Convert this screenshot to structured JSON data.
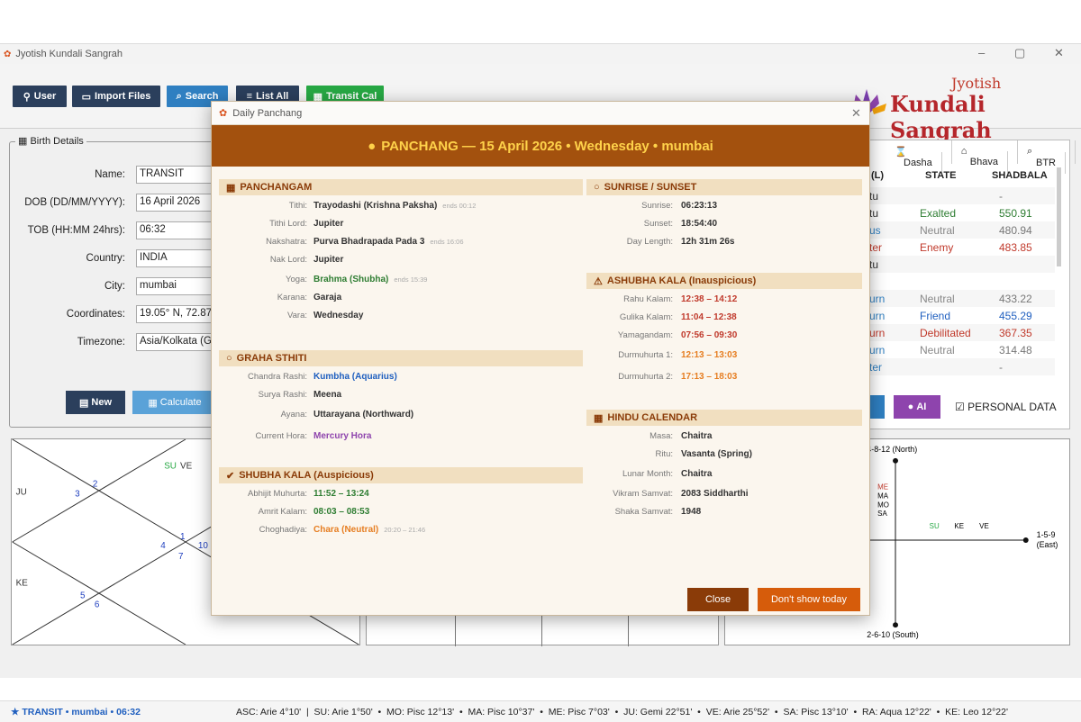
{
  "window": {
    "title": "Jyotish Kundali Sangrah"
  },
  "toolbar": {
    "user": "User",
    "import": "Import Files",
    "search": "Search",
    "listall": "List All",
    "transit": "Transit Cal"
  },
  "logo": {
    "line1": "Jyotish",
    "line2": "Kundali Sangrah"
  },
  "birth": {
    "legend": "Birth Details",
    "name_label": "Name:",
    "name": "TRANSIT",
    "dob_label": "DOB (DD/MM/YYYY):",
    "dob": "16 April 2026",
    "tob_label": "TOB (HH:MM 24hrs):",
    "tob": "06:32",
    "country_label": "Country:",
    "country": "INDIA",
    "city_label": "City:",
    "city": "mumbai",
    "coord_label": "Coordinates:",
    "coord": "19.05° N, 72.87",
    "tz_label": "Timezone:",
    "tz": "Asia/Kolkata (G",
    "new": "New",
    "calculate": "Calculate"
  },
  "rightpanel": {
    "tabs": [
      "Dasha",
      "Bhava",
      "BTR"
    ],
    "headers": [
      "(L)",
      "STATE",
      "SHADBALA"
    ],
    "rows": [
      {
        "l": "tu",
        "state": "",
        "val": "-"
      },
      {
        "l": "tu",
        "state": "Exalted",
        "val": "550.91"
      },
      {
        "l": "us",
        "state": "Neutral",
        "val": "480.94"
      },
      {
        "l": "ter",
        "state": "Enemy",
        "val": "483.85"
      },
      {
        "l": "tu",
        "state": "",
        "val": ""
      },
      {
        "l": "",
        "state": "",
        "val": ""
      },
      {
        "l": "urn",
        "state": "Neutral",
        "val": "433.22"
      },
      {
        "l": "urn",
        "state": "Friend",
        "val": "455.29"
      },
      {
        "l": "urn",
        "state": "Debilitated",
        "val": "367.35"
      },
      {
        "l": "urn",
        "state": "Neutral",
        "val": "314.48"
      },
      {
        "l": "ter",
        "state": "",
        "val": "-"
      }
    ],
    "ai": "AI",
    "personal": "PERSONAL DATA"
  },
  "leftchart": {
    "su": "SU",
    "ve": "VE",
    "ju": "JU",
    "ke": "KE",
    "n2": "2",
    "n3": "3",
    "n4": "4",
    "n1": "1",
    "n7": "7",
    "n10": "10",
    "n5": "5",
    "n6": "6"
  },
  "rightchart": {
    "north": "4-8-12 (North)",
    "south": "2-6-10 (South)",
    "east": "1-5-9\n(East)",
    "me": "ME",
    "ma": "MA",
    "mo": "MO",
    "sa": "SA",
    "su": "SU",
    "ke": "KE",
    "ve": "VE"
  },
  "status": {
    "left": "★ TRANSIT • mumbai • 06:32",
    "right": "ASC: Arie 4°10'  |  SU: Arie 1°50'  •  MO: Pisc 12°13'  •  MA: Pisc 10°37'  •  ME: Pisc 7°03'  •  JU: Gemi 22°51'  •  VE: Arie 25°52'  •  SA: Pisc 13°10'  •  RA: Aqua 12°22'  •  KE: Leo 12°22'"
  },
  "dialog": {
    "title": "Daily Panchang",
    "header": "PANCHANG — 15 April 2026 • Wednesday • mumbai",
    "panchangam": {
      "title": "PANCHANGAM",
      "items": [
        {
          "k": "Tithi:",
          "v": "Trayodashi (Krishna Paksha)",
          "e": "ends 00:12"
        },
        {
          "k": "Tithi Lord:",
          "v": "Jupiter",
          "e": ""
        },
        {
          "k": "Nakshatra:",
          "v": "Purva Bhadrapada Pada 3",
          "e": "ends 16:06"
        },
        {
          "k": "Nak Lord:",
          "v": "Jupiter",
          "e": ""
        },
        {
          "k": "Yoga:",
          "v": "Brahma (Shubha)",
          "e": "ends 15:39"
        },
        {
          "k": "Karana:",
          "v": "Garaja",
          "e": ""
        },
        {
          "k": "Vara:",
          "v": "Wednesday",
          "e": ""
        }
      ]
    },
    "graha": {
      "title": "GRAHA STHITI",
      "items": [
        {
          "k": "Chandra Rashi:",
          "v": "Kumbha (Aquarius)"
        },
        {
          "k": "Surya Rashi:",
          "v": "Meena"
        },
        {
          "k": "Ayana:",
          "v": "Uttarayana (Northward)"
        },
        {
          "k": "Current Hora:",
          "v": "Mercury Hora"
        }
      ]
    },
    "shubha": {
      "title": "SHUBHA KALA (Auspicious)",
      "items": [
        {
          "k": "Abhijit Muhurta:",
          "v": "11:52 – 13:24",
          "e": ""
        },
        {
          "k": "Amrit Kalam:",
          "v": "08:03 – 08:53",
          "e": ""
        },
        {
          "k": "Choghadiya:",
          "v": "Chara (Neutral)",
          "e": "20:20 – 21:46"
        }
      ]
    },
    "sunrise": {
      "title": "SUNRISE / SUNSET",
      "items": [
        {
          "k": "Sunrise:",
          "v": "06:23:13"
        },
        {
          "k": "Sunset:",
          "v": "18:54:40"
        },
        {
          "k": "Day Length:",
          "v": "12h 31m 26s"
        }
      ]
    },
    "ashubha": {
      "title": "ASHUBHA KALA (Inauspicious)",
      "items": [
        {
          "k": "Rahu Kalam:",
          "v": "12:38 – 14:12"
        },
        {
          "k": "Gulika Kalam:",
          "v": "11:04 – 12:38"
        },
        {
          "k": "Yamagandam:",
          "v": "07:56 – 09:30"
        },
        {
          "k": "Durmuhurta 1:",
          "v": "12:13 – 13:03"
        },
        {
          "k": "Durmuhurta 2:",
          "v": "17:13 – 18:03"
        }
      ]
    },
    "hindu": {
      "title": "HINDU CALENDAR",
      "items": [
        {
          "k": "Masa:",
          "v": "Chaitra"
        },
        {
          "k": "Ritu:",
          "v": "Vasanta (Spring)"
        },
        {
          "k": "Lunar Month:",
          "v": "Chaitra"
        },
        {
          "k": "Vikram Samvat:",
          "v": "2083 Siddharthi"
        },
        {
          "k": "Shaka Samvat:",
          "v": "1948"
        }
      ]
    },
    "close": "Close",
    "dontshow": "Don't show today"
  }
}
